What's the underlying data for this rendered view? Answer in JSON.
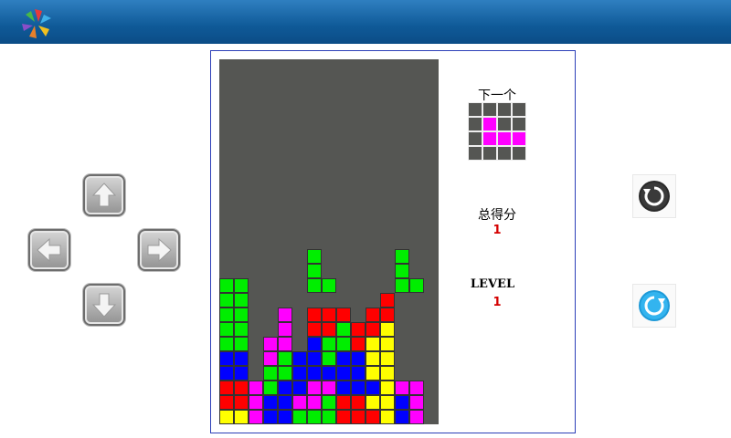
{
  "header": {
    "logo_icon": "pinwheel-logo-icon"
  },
  "controls": {
    "up": "arrow-up-icon",
    "left": "arrow-left-icon",
    "right": "arrow-right-icon",
    "down": "arrow-down-icon",
    "rotate_ccw": "rotate-ccw-icon",
    "rotate_cw": "rotate-cw-icon"
  },
  "sidebar": {
    "next_label": "下一个",
    "score_label": "总得分",
    "score_value": "1",
    "level_label": "LEVEL",
    "level_value": "1"
  },
  "colors": {
    "board_bg": "#555653",
    "grid_line": "#444444",
    "G": "#00ee00",
    "B": "#0000ff",
    "R": "#ff0000",
    "M": "#ff00ff",
    "Y": "#ffff00"
  },
  "next_piece": [
    "....",
    ".M..",
    ".MMM",
    "...."
  ],
  "board_rows": [
    "...............",
    "...............",
    "...............",
    "...............",
    "...............",
    "...............",
    "...............",
    "...............",
    "...............",
    "...............",
    "...............",
    "...............",
    "...............",
    "......G.....G..",
    "......G.....G..",
    "GG....GG....GG.",
    "GG.........R...",
    "GG..M.RRR.RR...",
    "GG..M.RRGRRY...",
    "GG.MM.BGGRYY...",
    "BB.MGBBGBBYY...",
    "BB.GGBBBBBYY...",
    "RRMGBBMMBBBYMM.",
    "RRMBBMMGRRYYBM.",
    "YYMBBGGGRRRYBM."
  ]
}
